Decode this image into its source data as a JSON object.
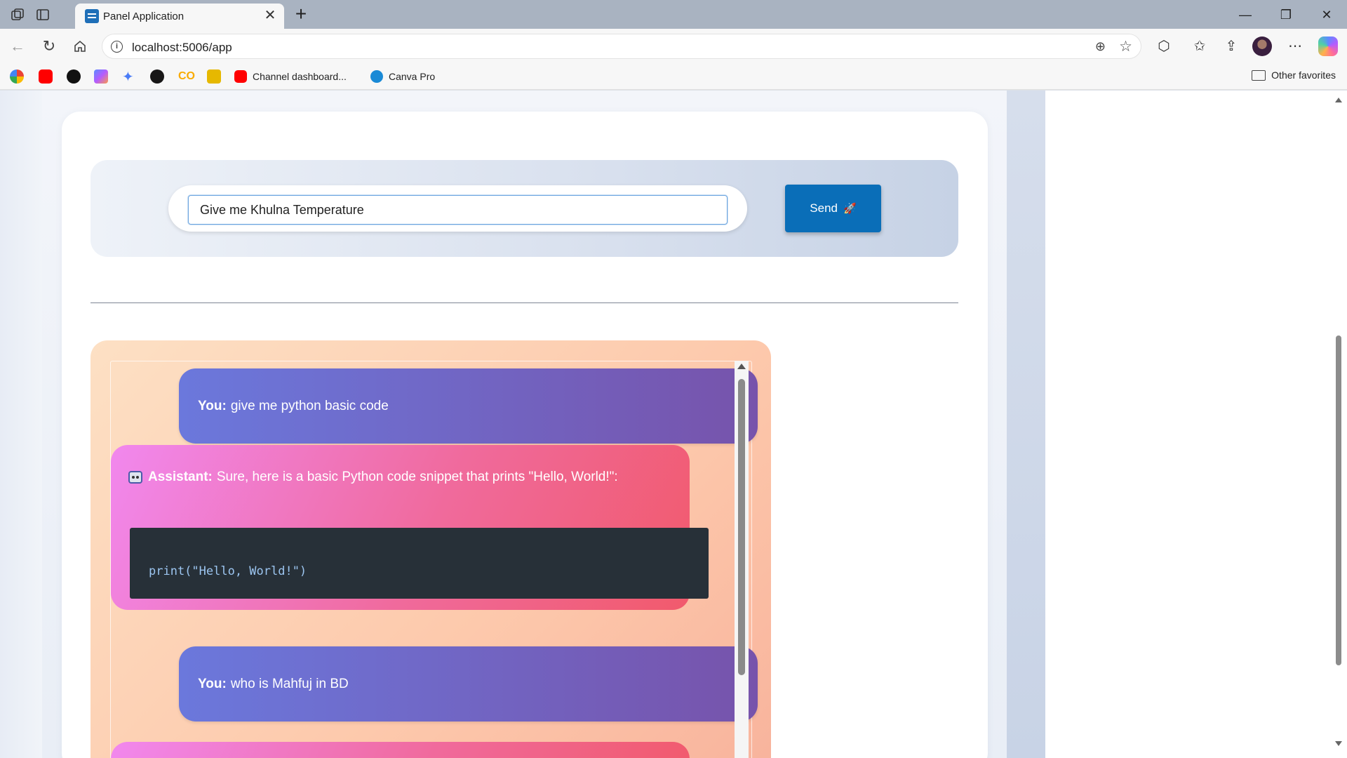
{
  "browser": {
    "tab_title": "Panel Application",
    "url": "localhost:5006/app",
    "bookmarks": [
      {
        "label": "",
        "icon": "google-icon",
        "color": "#4285f4"
      },
      {
        "label": "",
        "icon": "youtube-icon",
        "color": "#ff0000"
      },
      {
        "label": "",
        "icon": "openai-icon",
        "color": "#111111"
      },
      {
        "label": "",
        "icon": "copilot-icon",
        "color": "#8a5cf6"
      },
      {
        "label": "",
        "icon": "gemini-icon",
        "color": "#4a7cf7"
      },
      {
        "label": "",
        "icon": "github-icon",
        "color": "#181717"
      },
      {
        "label": "",
        "icon": "colab-icon",
        "color": "#f9ab00"
      },
      {
        "label": "",
        "icon": "sheets-icon",
        "color": "#e6b800"
      },
      {
        "label": "Channel dashboard...",
        "icon": "youtube-icon",
        "color": "#ff0000"
      },
      {
        "label": "Canva Pro",
        "icon": "canva-icon",
        "color": "#1a8ad6"
      }
    ],
    "other_favorites": "Other favorites"
  },
  "app": {
    "input": {
      "value": "Give me Khulna Temperature",
      "send_label": "Send",
      "send_icon": "rocket-icon"
    },
    "messages": [
      {
        "role": "user",
        "who": "You:",
        "text": "give me python basic code"
      },
      {
        "role": "assistant",
        "who": "Assistant:",
        "text": "Sure, here is a basic Python code snippet that prints \"Hello, World!\":",
        "code": "print(\"Hello, World!\")"
      },
      {
        "role": "user",
        "who": "You:",
        "text": "who is Mahfuj in BD"
      }
    ]
  },
  "colors": {
    "send_button": "#0a6eb8",
    "user_bubble_start": "#6b78dc",
    "user_bubble_end": "#7753ab",
    "assistant_bubble_start": "#f188ee",
    "assistant_bubble_end": "#f15a6c",
    "code_background": "#273038"
  }
}
